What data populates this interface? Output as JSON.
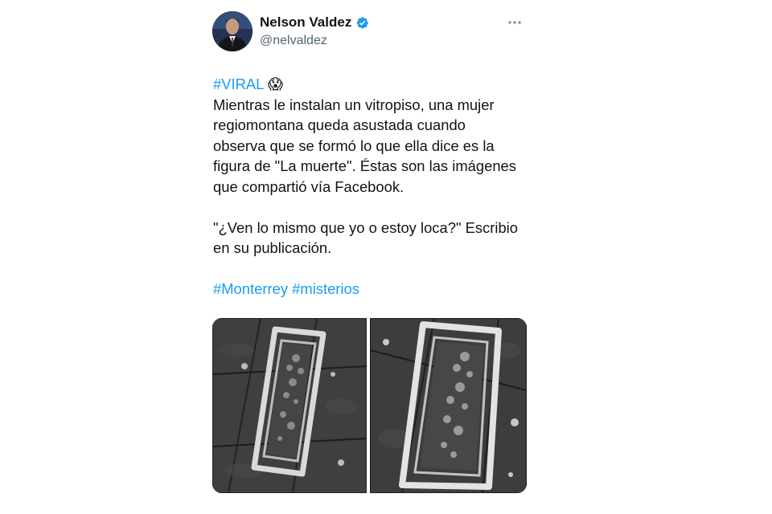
{
  "tweet": {
    "author_name": "Nelson Valdez",
    "handle": "@nelvaldez",
    "verified": true,
    "verified_color": "#1d9bf0",
    "more_icon": "more-horizontal-icon",
    "text": {
      "hashtag_viral": "#VIRAL",
      "emoji": "😱",
      "line1": "Mientras le instalan un vitropiso, una mujer",
      "line2": "regiomontana queda asustada cuando",
      "line3": "observa que se formó lo que ella dice es la",
      "line4": "figura de \"La muerte\". Éstas son las imágenes",
      "line5": "que compartió vía Facebook.",
      "line6": "\"¿Ven lo mismo que yo o estoy loca?\" Escribio",
      "line7": "en su publicación.",
      "hashtag_monterrey": "#Monterrey",
      "hashtag_misterios": "#misterios"
    },
    "media": [
      {
        "name": "floor-photo-left"
      },
      {
        "name": "floor-photo-right"
      }
    ]
  },
  "colors": {
    "text": "#0f1419",
    "secondary": "#536471",
    "link": "#1d9bf0"
  }
}
